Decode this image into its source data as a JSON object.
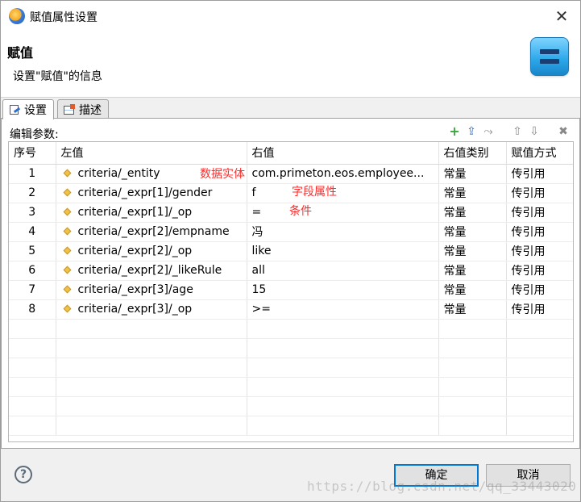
{
  "window": {
    "title": "赋值属性设置",
    "close_icon": "close-icon",
    "app_icon": "eos-app-icon"
  },
  "banner": {
    "title": "赋值",
    "description": "设置\"赋值\"的信息",
    "icon": "assign-equals-icon"
  },
  "tabs": [
    {
      "label": "设置",
      "icon": "settings-doc-icon",
      "active": true
    },
    {
      "label": "描述",
      "icon": "describe-grid-icon",
      "active": false
    }
  ],
  "panel": {
    "label": "编辑参数:",
    "toolbar": {
      "add": "+",
      "import": "⇪",
      "branch": "⤳",
      "up": "⇧",
      "down": "⇩",
      "delete": "✖"
    }
  },
  "table": {
    "columns": [
      "序号",
      "左值",
      "右值",
      "右值类别",
      "赋值方式"
    ],
    "rows": [
      {
        "index": "1",
        "left": "criteria/_entity",
        "right": "com.primeton.eos.employee...",
        "right_type": "常量",
        "mode": "传引用"
      },
      {
        "index": "2",
        "left": "criteria/_expr[1]/gender",
        "right": "f",
        "right_type": "常量",
        "mode": "传引用"
      },
      {
        "index": "3",
        "left": "criteria/_expr[1]/_op",
        "right": "=",
        "right_type": "常量",
        "mode": "传引用"
      },
      {
        "index": "4",
        "left": "criteria/_expr[2]/empname",
        "right": "冯",
        "right_type": "常量",
        "mode": "传引用"
      },
      {
        "index": "5",
        "left": "criteria/_expr[2]/_op",
        "right": "like",
        "right_type": "常量",
        "mode": "传引用"
      },
      {
        "index": "6",
        "left": "criteria/_expr[2]/_likeRule",
        "right": "all",
        "right_type": "常量",
        "mode": "传引用"
      },
      {
        "index": "7",
        "left": "criteria/_expr[3]/age",
        "right": "15",
        "right_type": "常量",
        "mode": "传引用"
      },
      {
        "index": "8",
        "left": "criteria/_expr[3]/_op",
        "right": ">=",
        "right_type": "常量",
        "mode": "传引用"
      }
    ]
  },
  "annotations": {
    "entity": "数据实体",
    "field": "字段属性",
    "condition": "条件"
  },
  "footer": {
    "help_icon": "help-icon",
    "ok_label": "确定",
    "cancel_label": "取消"
  },
  "watermark": "https://blog.csdn.net/qq_33443020",
  "colors": {
    "annotation": "#ff2a2a",
    "primary_border": "#0078d7"
  }
}
